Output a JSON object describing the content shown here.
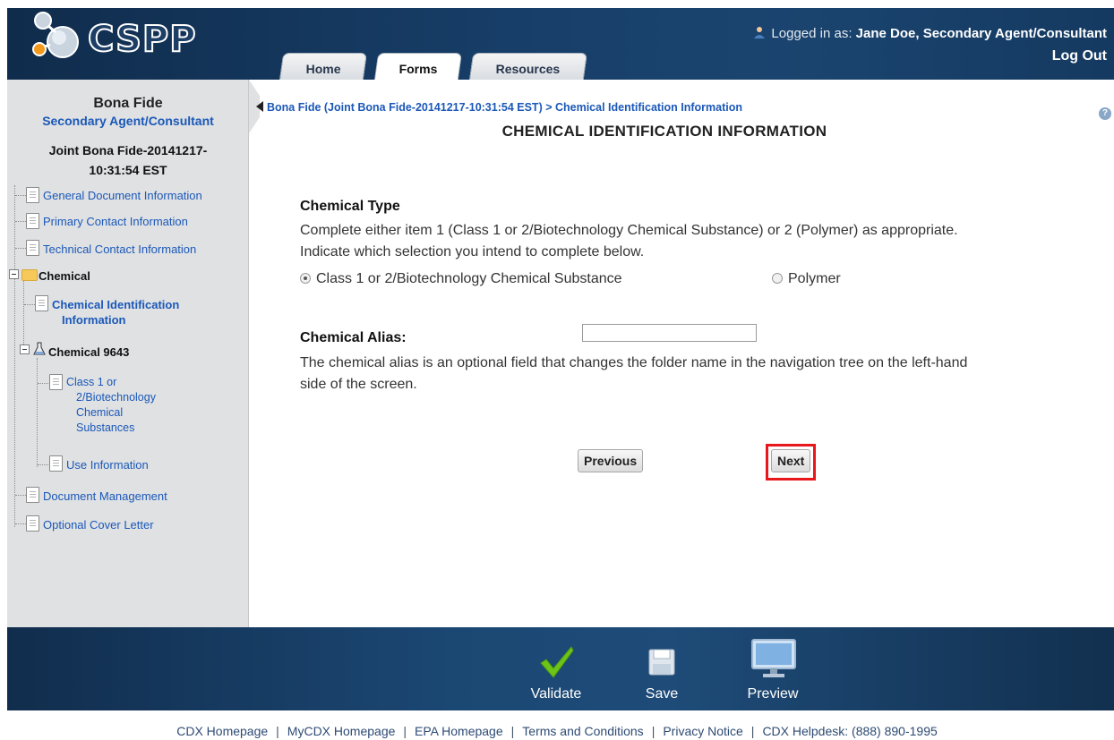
{
  "app": {
    "logo_text": "CSPP"
  },
  "header": {
    "tabs": [
      {
        "label": "Home",
        "active": false
      },
      {
        "label": "Forms",
        "active": true
      },
      {
        "label": "Resources",
        "active": false
      }
    ],
    "logged_in_label": "Logged in as:",
    "user_name": "Jane Doe, Secondary Agent/Consultant",
    "logout_label": "Log Out"
  },
  "sidebar": {
    "title": "Bona Fide",
    "role": "Secondary Agent/Consultant",
    "document_line1": "Joint Bona Fide-20141217-",
    "document_line2": "10:31:54 EST",
    "items": {
      "general": "General Document Information",
      "primary_contact": "Primary Contact Information",
      "technical_contact": "Technical Contact Information",
      "chemical_folder": "Chemical",
      "chem_id_line1": "Chemical Identification",
      "chem_id_line2": "Information",
      "chemical_node": "Chemical 9643",
      "class_line1": "Class 1 or",
      "class_line2": "2/Biotechnology",
      "class_line3": "Chemical",
      "class_line4": "Substances",
      "use_info": "Use Information",
      "doc_mgmt": "Document Management",
      "cover_letter": "Optional Cover Letter"
    }
  },
  "main": {
    "breadcrumb": "Bona Fide (Joint Bona Fide-20141217-10:31:54 EST) > Chemical Identification Information",
    "title": "CHEMICAL IDENTIFICATION INFORMATION",
    "chemical_type_label": "Chemical Type",
    "chemical_type_text_1": "Complete either item 1 (Class 1 or 2/Biotechnology Chemical Substance) or 2 (Polymer) as appropriate.",
    "chemical_type_text_2": "Indicate which selection you intend to complete below.",
    "radio_class": "Class 1 or 2/Biotechnology Chemical Substance",
    "radio_class_selected": true,
    "radio_polymer": "Polymer",
    "alias_label": "Chemical Alias:",
    "alias_value": "",
    "alias_text_1": "The chemical alias is an optional field that changes the folder name in the navigation tree on the left-hand",
    "alias_text_2": "side of the screen.",
    "previous_label": "Previous",
    "next_label": "Next"
  },
  "footer": {
    "validate_label": "Validate",
    "save_label": "Save",
    "preview_label": "Preview",
    "links": {
      "cdx_home": "CDX Homepage",
      "mycdx_home": "MyCDX Homepage",
      "epa_home": "EPA Homepage",
      "terms": "Terms and Conditions",
      "privacy": "Privacy Notice",
      "helpdesk": "CDX Helpdesk: (888) 890-1995"
    },
    "separator": "|"
  },
  "colors": {
    "header_bg": "#173e68",
    "link_blue": "#1b58b8",
    "highlight_red": "#e8171b",
    "validate_check": "#6cc417"
  }
}
